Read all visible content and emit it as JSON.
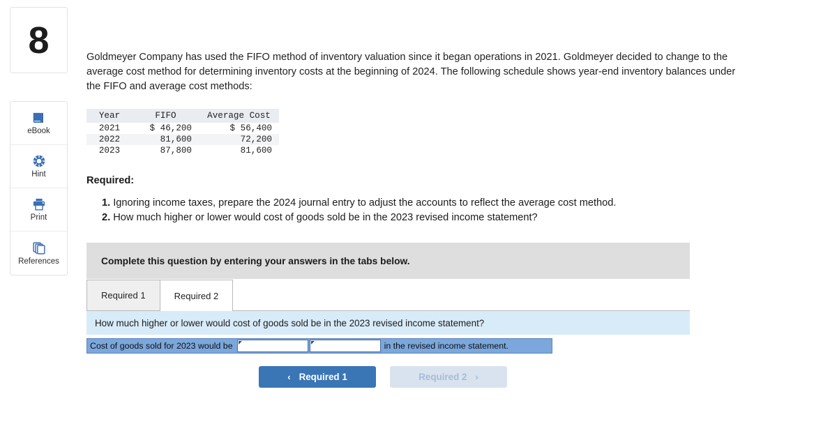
{
  "question": {
    "number": "8",
    "intro": "Goldmeyer Company has used the FIFO method of inventory valuation since it began operations in 2021. Goldmeyer decided to change to the average cost method for determining inventory costs at the beginning of 2024. The following schedule shows year-end inventory balances under the FIFO and average cost methods:",
    "required_heading": "Required:",
    "requirements": [
      {
        "num": "1.",
        "text": "Ignoring income taxes, prepare the 2024 journal entry to adjust the accounts to reflect the average cost method."
      },
      {
        "num": "2.",
        "text": "How much higher or lower would cost of goods sold be in the 2023 revised income statement?"
      }
    ]
  },
  "tools": [
    {
      "label": "eBook",
      "icon": "book-icon"
    },
    {
      "label": "Hint",
      "icon": "life-ring-icon"
    },
    {
      "label": "Print",
      "icon": "printer-icon"
    },
    {
      "label": "References",
      "icon": "copy-pages-icon"
    }
  ],
  "inventory_table": {
    "headers": [
      "Year",
      "FIFO",
      "Average Cost"
    ],
    "rows": [
      {
        "year": "2021",
        "fifo": "$ 46,200",
        "avg": "$ 56,400"
      },
      {
        "year": "2022",
        "fifo": "81,600",
        "avg": "72,200"
      },
      {
        "year": "2023",
        "fifo": "87,800",
        "avg": "81,600"
      }
    ]
  },
  "widget": {
    "complete_banner": "Complete this question by entering your answers in the tabs below.",
    "tabs": [
      {
        "label": "Required 1",
        "active": false
      },
      {
        "label": "Required 2",
        "active": true
      }
    ],
    "question_bar": "How much higher or lower would cost of goods sold be in the 2023 revised income statement?",
    "answer_row": {
      "label": "Cost of goods sold for 2023 would be",
      "input_1_value": "",
      "input_2_value": "",
      "tail": "in the revised income statement."
    },
    "nav": {
      "prev_label": "Required 1",
      "prev_chevron": "‹",
      "next_label": "Required 2",
      "next_chevron": "›"
    }
  },
  "colors": {
    "primary_button": "#3a75b6",
    "disabled_button": "#d9e3ef",
    "question_bar": "#d8ebf8",
    "answer_row": "#7ba7dc",
    "banner": "#dedede",
    "table_header": "#e9edf1",
    "icon_blue": "#3b6fb5"
  }
}
